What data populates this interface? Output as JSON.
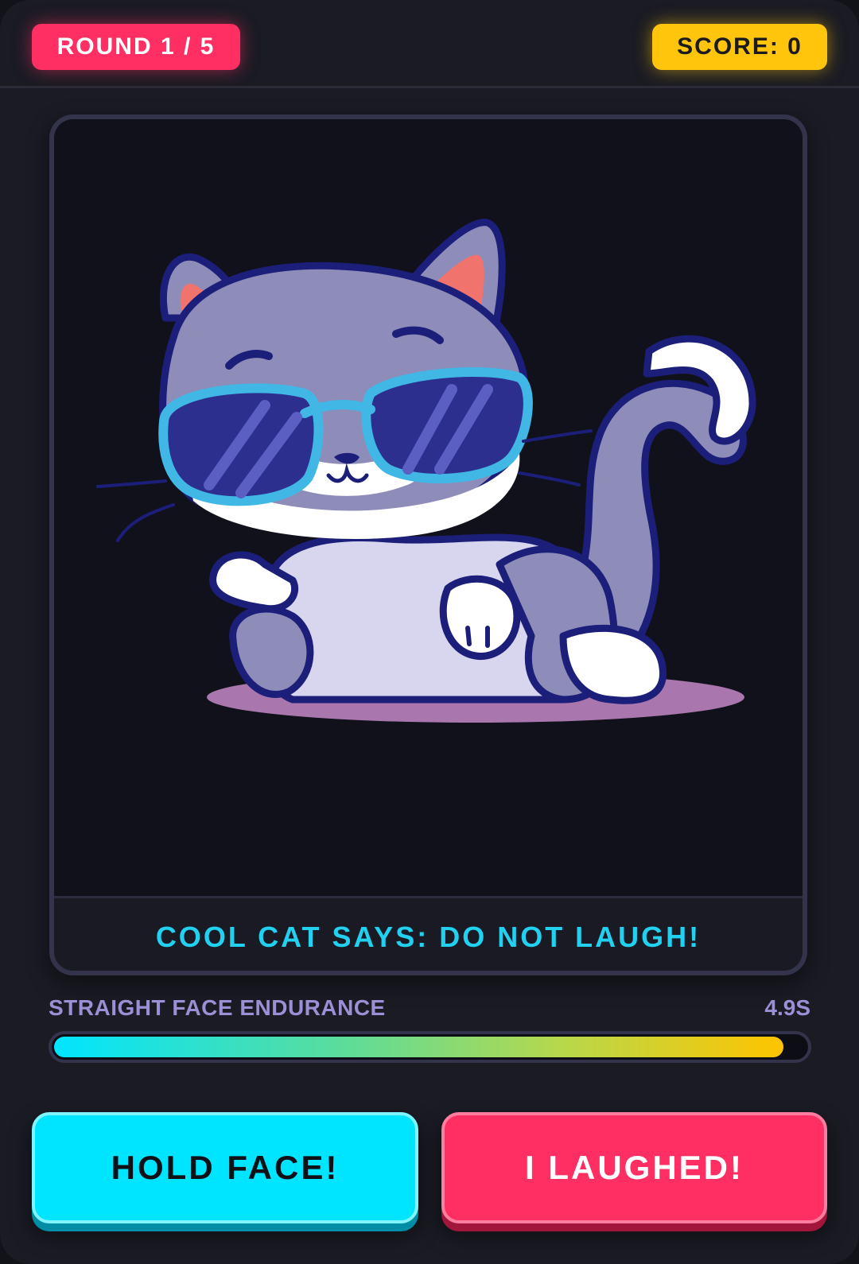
{
  "header": {
    "round_label": "ROUND 1 / 5",
    "score_label": "SCORE: 0"
  },
  "card": {
    "image": "cool-cat-with-sunglasses",
    "caption": "COOL CAT SAYS: DO NOT LAUGH!"
  },
  "meter": {
    "label": "STRAIGHT FACE ENDURANCE",
    "value_label": "4.9S",
    "fill_fraction": 0.97
  },
  "actions": {
    "hold_label": "HOLD FACE!",
    "laugh_label": "I LAUGHED!"
  },
  "colors": {
    "accent_pink": "#ff2e63",
    "accent_yellow": "#ffc40c",
    "accent_cyan": "#00e5ff",
    "background": "#1a1b23"
  }
}
